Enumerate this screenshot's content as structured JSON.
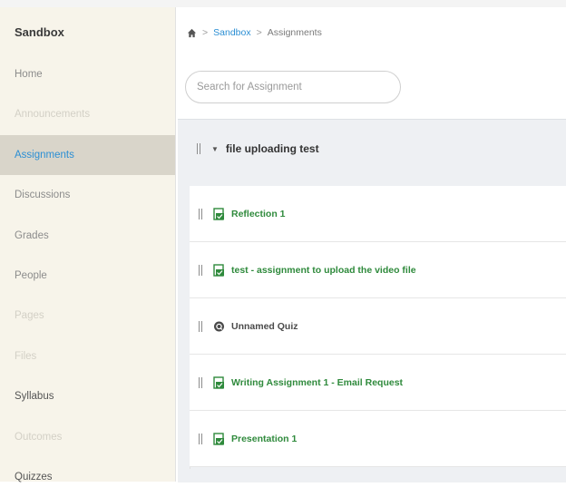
{
  "course": {
    "name": "Sandbox"
  },
  "sidebar": {
    "items": [
      {
        "label": "Home",
        "state": "normal"
      },
      {
        "label": "Announcements",
        "state": "dim"
      },
      {
        "label": "Assignments",
        "state": "active"
      },
      {
        "label": "Discussions",
        "state": "normal"
      },
      {
        "label": "Grades",
        "state": "normal"
      },
      {
        "label": "People",
        "state": "normal"
      },
      {
        "label": "Pages",
        "state": "dim"
      },
      {
        "label": "Files",
        "state": "dim"
      },
      {
        "label": "Syllabus",
        "state": "dark"
      },
      {
        "label": "Outcomes",
        "state": "dim"
      },
      {
        "label": "Quizzes",
        "state": "dark"
      }
    ]
  },
  "breadcrumb": {
    "home_icon": "home-icon",
    "course": "Sandbox",
    "page": "Assignments"
  },
  "search": {
    "placeholder": "Search for Assignment",
    "value": ""
  },
  "group": {
    "title": "file uploading test"
  },
  "assignments": [
    {
      "title": "Reflection 1",
      "icon": "assignment-icon",
      "type": "assignment"
    },
    {
      "title": "test - assignment to upload the video file",
      "icon": "assignment-icon",
      "type": "assignment"
    },
    {
      "title": "Unnamed Quiz",
      "icon": "quiz-icon",
      "type": "quiz"
    },
    {
      "title": "Writing Assignment 1 - Email Request",
      "icon": "assignment-icon",
      "type": "assignment"
    },
    {
      "title": "Presentation 1",
      "icon": "assignment-icon",
      "type": "assignment"
    }
  ],
  "colors": {
    "accent": "#2c8fd4",
    "assignment": "#2f8a3c",
    "sidebar_bg": "#f7f4ea",
    "sidebar_active": "#d9d5ca"
  }
}
